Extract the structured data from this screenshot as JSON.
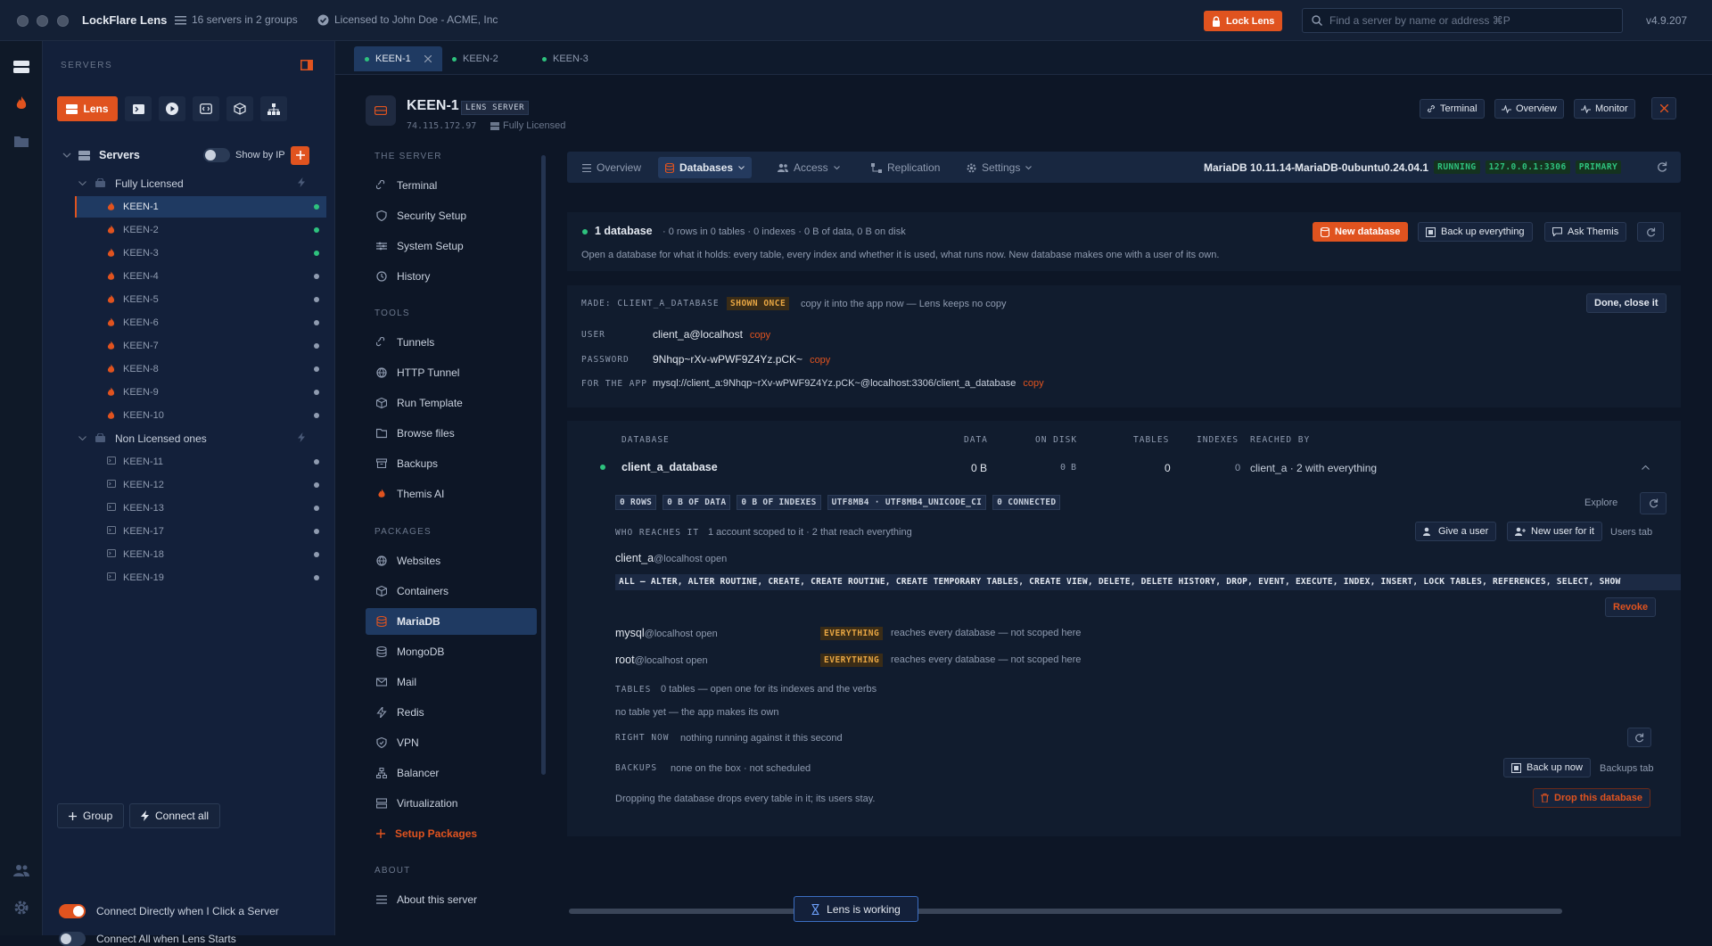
{
  "titlebar": {
    "app_name": "LockFlare Lens",
    "servers_summary": "16 servers in 2 groups",
    "license": "Licensed to John Doe - ACME, Inc",
    "lock_label": "Lock Lens",
    "search_placeholder": "Find a server by name or address  ⌘P",
    "version": "v4.9.207"
  },
  "sidebar": {
    "heading": "SERVERS",
    "lens_button": "Lens",
    "tree_root": "Servers",
    "show_by_ip": "Show by IP",
    "groups": [
      {
        "name": "Fully Licensed",
        "servers": [
          {
            "name": "KEEN-1",
            "status": "online",
            "selected": true
          },
          {
            "name": "KEEN-2",
            "status": "online"
          },
          {
            "name": "KEEN-3",
            "status": "online"
          },
          {
            "name": "KEEN-4",
            "status": "idle"
          },
          {
            "name": "KEEN-5",
            "status": "idle"
          },
          {
            "name": "KEEN-6",
            "status": "idle"
          },
          {
            "name": "KEEN-7",
            "status": "idle"
          },
          {
            "name": "KEEN-8",
            "status": "idle"
          },
          {
            "name": "KEEN-9",
            "status": "idle"
          },
          {
            "name": "KEEN-10",
            "status": "idle"
          }
        ]
      },
      {
        "name": "Non Licensed ones",
        "servers": [
          {
            "name": "KEEN-11",
            "status": "idle"
          },
          {
            "name": "KEEN-12",
            "status": "idle"
          },
          {
            "name": "KEEN-13",
            "status": "idle"
          },
          {
            "name": "KEEN-17",
            "status": "idle"
          },
          {
            "name": "KEEN-18",
            "status": "idle"
          },
          {
            "name": "KEEN-19",
            "status": "idle"
          }
        ]
      }
    ],
    "group_button": "Group",
    "connect_all_button": "Connect all",
    "toggle_connect_direct": {
      "label": "Connect Directly when I Click a Server",
      "on": true
    },
    "toggle_connect_start": {
      "label": "Connect All when Lens Starts",
      "on": false
    }
  },
  "tabs": [
    "KEEN-1",
    "KEEN-2",
    "KEEN-3"
  ],
  "server": {
    "name": "KEEN-1",
    "badge": "LENS SERVER",
    "ip": "74.115.172.97",
    "license": "Fully Licensed",
    "actions": {
      "terminal": "Terminal",
      "overview": "Overview",
      "monitor": "Monitor"
    }
  },
  "nav": {
    "sections": {
      "server": "THE SERVER",
      "tools": "TOOLS",
      "packages": "PACKAGES",
      "about": "ABOUT"
    },
    "server_items": [
      "Terminal",
      "Security Setup",
      "System Setup",
      "History"
    ],
    "tool_items": [
      "Tunnels",
      "HTTP Tunnel",
      "Run Template",
      "Browse files",
      "Backups",
      "Themis AI"
    ],
    "package_items": [
      "Websites",
      "Containers",
      "MariaDB",
      "MongoDB",
      "Mail",
      "Redis",
      "VPN",
      "Balancer",
      "Virtualization"
    ],
    "setup_packages": "Setup Packages",
    "about_item": "About this server"
  },
  "dbbar": {
    "tabs": [
      "Overview",
      "Databases",
      "Access",
      "Replication",
      "Settings"
    ],
    "version": "MariaDB 10.11.14-MariaDB-0ubuntu0.24.04.1",
    "status": "RUNNING",
    "address": "127.0.0.1:3306",
    "role": "PRIMARY"
  },
  "summary": {
    "count": "1 database",
    "details": "· 0 rows in 0 tables · 0 indexes · 0 B of data, 0 B on disk",
    "help": "Open a database for what it holds: every table, every index and whether it is used, what runs now. New database makes one with a user of its own.",
    "new_db": "New database",
    "backup_all": "Back up everything",
    "ask": "Ask Themis"
  },
  "made": {
    "label": "MADE: CLIENT_A_DATABASE",
    "shown_once": "SHOWN ONCE",
    "note": "copy it into the app now — Lens keeps no copy",
    "done": "Done, close it",
    "user_label": "USER",
    "user": "client_a@localhost",
    "password_label": "PASSWORD",
    "password": "9Nhqp~rXv-wPWF9Z4Yz.pCK~",
    "app_label": "FOR THE APP",
    "dsn": "mysql://client_a:9Nhqp~rXv-wPWF9Z4Yz.pCK~@localhost:3306/client_a_database",
    "copy": "copy"
  },
  "table": {
    "headers": [
      "DATABASE",
      "DATA",
      "ON DISK",
      "TABLES",
      "INDEXES",
      "REACHED BY"
    ],
    "row": {
      "name": "client_a_database",
      "data": "0 B",
      "disk": "0 B",
      "tables": "0",
      "indexes": "0",
      "reached": "client_a · 2 with everything"
    }
  },
  "detail": {
    "chips": [
      "0 ROWS",
      "0 B OF DATA",
      "0 B OF INDEXES",
      "UTF8MB4 · UTF8MB4_UNICODE_CI",
      "0 CONNECTED"
    ],
    "explore": "Explore",
    "who_label": "WHO REACHES IT",
    "who_text": "1 account scoped to it · 2 that reach everything",
    "give_user": "Give a user",
    "new_user": "New user for it",
    "users_tab": "Users tab",
    "user1": {
      "name": "client_a",
      "host": "@localhost open"
    },
    "grants": "ALL — ALTER, ALTER ROUTINE, CREATE, CREATE ROUTINE, CREATE TEMPORARY TABLES, CREATE VIEW, DELETE, DELETE HISTORY, DROP, EVENT, EXECUTE, INDEX, INSERT, LOCK TABLES, REFERENCES, SELECT, SHOW",
    "revoke": "Revoke",
    "user2": {
      "name": "mysql",
      "host": "@localhost open",
      "badge": "EVERYTHING",
      "note": "reaches every database — not scoped here"
    },
    "user3": {
      "name": "root",
      "host": "@localhost open",
      "badge": "EVERYTHING",
      "note": "reaches every database — not scoped here"
    },
    "tables_label": "TABLES",
    "tables_text": "0 tables — open one for its indexes and the verbs",
    "no_table": "no table yet — the app makes its own",
    "now_label": "RIGHT NOW",
    "now_text": "nothing running against it this second",
    "backups_label": "BACKUPS",
    "backups_text": "none on the box · not scheduled",
    "backup_now": "Back up now",
    "backups_tab": "Backups tab",
    "drop_note": "Dropping the database drops every table in it; its users stay.",
    "drop_btn": "Drop this database"
  },
  "status_toast": "Lens is working",
  "colors": {
    "accent": "#e0531f",
    "online": "#2ec27e",
    "selected": "#1f3a62"
  }
}
